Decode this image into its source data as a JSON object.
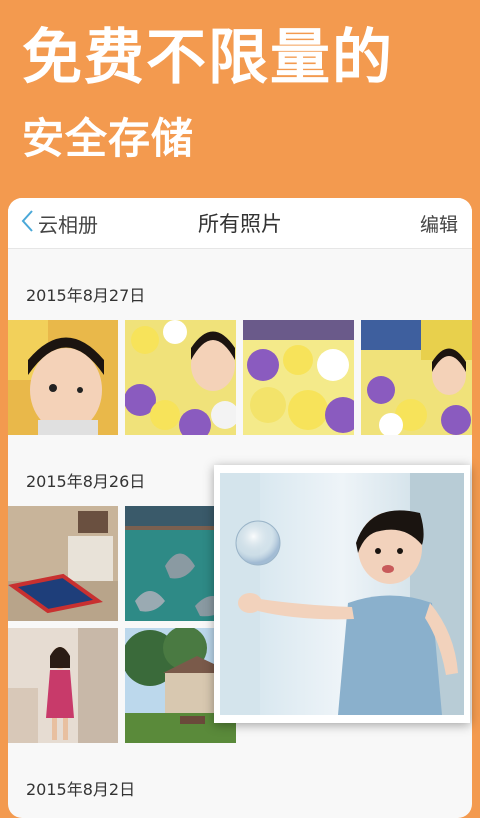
{
  "promo": {
    "title": "免费不限量的",
    "subtitle": "安全存储"
  },
  "nav": {
    "back_label": "云相册",
    "title": "所有照片",
    "edit_label": "编辑"
  },
  "groups": [
    {
      "date": "2015年8月27日"
    },
    {
      "date": "2015年8月26日"
    },
    {
      "date": "2015年8月2日"
    }
  ],
  "colors": {
    "background": "#f39a4f",
    "card": "#f8f8f8",
    "accent_back": "#4aa8d8"
  }
}
